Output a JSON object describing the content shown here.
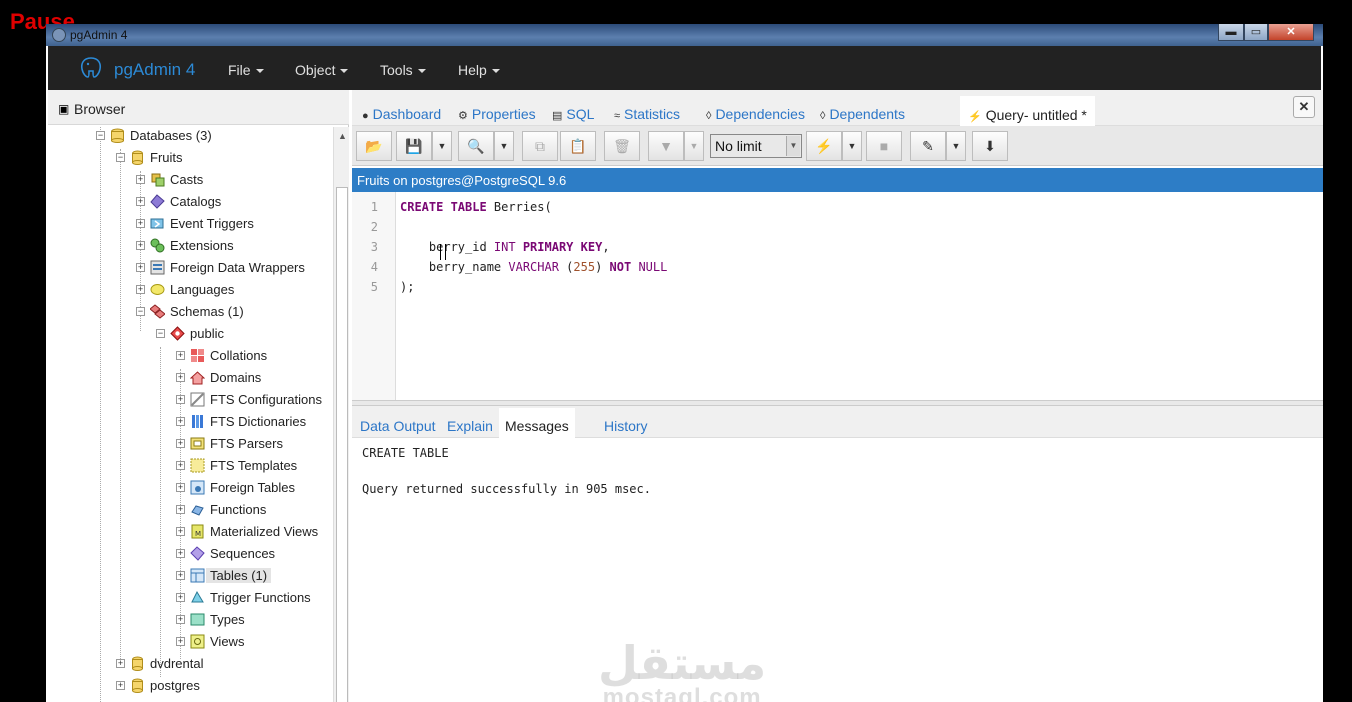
{
  "overlay": {
    "pause_label": "Pause"
  },
  "window": {
    "title": "pgAdmin 4",
    "buttons": {
      "minimize": "▬",
      "maximize": "▭",
      "close": "✕"
    }
  },
  "app": {
    "brand": "pgAdmin 4",
    "menu": [
      {
        "label": "File"
      },
      {
        "label": "Object"
      },
      {
        "label": "Tools"
      },
      {
        "label": "Help"
      }
    ]
  },
  "browser": {
    "title": "Browser",
    "tree": {
      "databases": "Databases (3)",
      "fruits": "Fruits",
      "casts": "Casts",
      "catalogs": "Catalogs",
      "event_triggers": "Event Triggers",
      "extensions": "Extensions",
      "fdw": "Foreign Data Wrappers",
      "languages": "Languages",
      "schemas": "Schemas (1)",
      "public": "public",
      "collations": "Collations",
      "domains": "Domains",
      "fts_configurations": "FTS Configurations",
      "fts_dictionaries": "FTS Dictionaries",
      "fts_parsers": "FTS Parsers",
      "fts_templates": "FTS Templates",
      "foreign_tables": "Foreign Tables",
      "functions": "Functions",
      "materialized_views": "Materialized Views",
      "sequences": "Sequences",
      "tables": "Tables (1)",
      "trigger_functions": "Trigger Functions",
      "types": "Types",
      "views": "Views",
      "dvdrental": "dvdrental",
      "postgres": "postgres"
    }
  },
  "tabs": {
    "dashboard": "Dashboard",
    "properties": "Properties",
    "sql": "SQL",
    "statistics": "Statistics",
    "dependencies": "Dependencies",
    "dependents": "Dependents",
    "query": "Query- untitled *"
  },
  "toolbar": {
    "limit": "No limit"
  },
  "connection": "Fruits on postgres@PostgreSQL 9.6",
  "editor": {
    "line_numbers": [
      "1",
      "2",
      "3",
      "4",
      "5"
    ],
    "lines": {
      "l1_kw": "CREATE TABLE",
      "l1_rest": " Berries(",
      "l3_name": "    berry_id ",
      "l3_type": "INT",
      "l3_kw": " PRIMARY KEY",
      "l3_end": ",",
      "l4_name": "    berry_name ",
      "l4_type": "VARCHAR",
      "l4_open": " (",
      "l4_num": "255",
      "l4_close": ") ",
      "l4_kw": "NOT",
      "l4_null": " NULL",
      "l5": ");"
    }
  },
  "results": {
    "tabs": {
      "data_output": "Data Output",
      "explain": "Explain",
      "messages": "Messages",
      "history": "History"
    },
    "messages": [
      "CREATE TABLE",
      "Query returned successfully in 905 msec."
    ]
  },
  "watermark": {
    "arabic": "مستقل",
    "latin": "mostaql.com"
  }
}
